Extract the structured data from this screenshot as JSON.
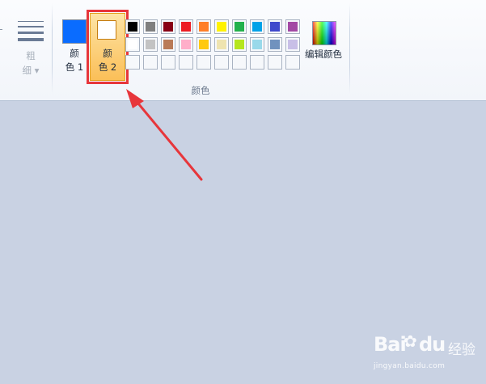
{
  "ribbon": {
    "size": {
      "label": "粗\n细 ▾"
    },
    "color1": {
      "label": "颜\n色 1",
      "swatch": "#0a6cff"
    },
    "color2": {
      "label": "颜\n色 2",
      "swatch": "#ffffff",
      "selected": true
    },
    "palette": {
      "rows": [
        [
          "#000000",
          "#7f7f7f",
          "#880015",
          "#ed1c24",
          "#ff7f27",
          "#fff200",
          "#22b14c",
          "#00a2e8",
          "#3f48cc",
          "#a349a4"
        ],
        [
          "#ffffff",
          "#c3c3c3",
          "#b97a57",
          "#ffaec9",
          "#ffc90e",
          "#efe4b0",
          "#b5e61d",
          "#99d9ea",
          "#7092be",
          "#c8bfe7"
        ],
        [
          null,
          null,
          null,
          null,
          null,
          null,
          null,
          null,
          null,
          null
        ]
      ]
    },
    "edit_colors": {
      "label": "编辑颜色"
    },
    "group_label": "颜色"
  },
  "annotation": {
    "highlight_color": "#e7363b",
    "arrow_color": "#e7363b"
  },
  "watermark": {
    "main": "Bai",
    "paw": "du",
    "cn": "经验",
    "sub": "jingyan.baidu.com"
  }
}
